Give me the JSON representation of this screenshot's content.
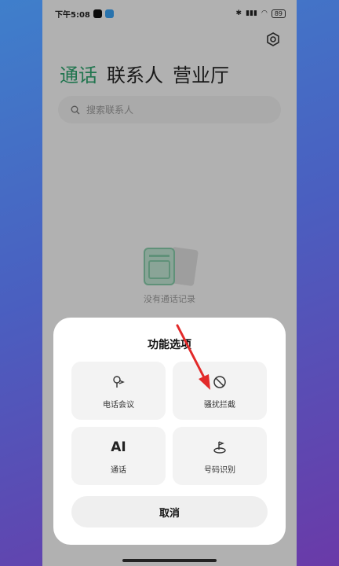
{
  "status_bar": {
    "time": "下午5:08",
    "battery": "89"
  },
  "tabs": [
    {
      "label": "通话",
      "active": true
    },
    {
      "label": "联系人",
      "active": false
    },
    {
      "label": "营业厅",
      "active": false
    }
  ],
  "search": {
    "placeholder": "搜索联系人"
  },
  "empty_state": {
    "text": "没有通话记录"
  },
  "dialog": {
    "title": "功能选项",
    "options": [
      {
        "label": "电话会议",
        "icon": "conference-icon"
      },
      {
        "label": "骚扰拦截",
        "icon": "block-icon"
      },
      {
        "label": "通话",
        "icon_text": "AI"
      },
      {
        "label": "号码识别",
        "icon": "number-id-icon"
      }
    ],
    "cancel_label": "取消"
  },
  "colors": {
    "accent": "#2fa36e",
    "annotation_arrow": "#e22a2a"
  }
}
